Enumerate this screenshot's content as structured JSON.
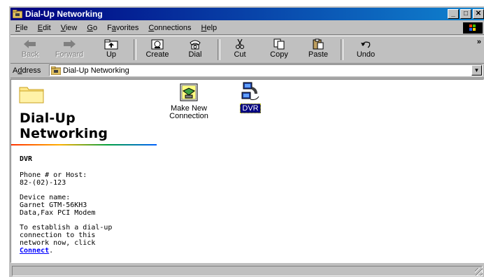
{
  "window": {
    "title": "Dial-Up Networking"
  },
  "title_buttons": {
    "minimize": "_",
    "maximize": "□",
    "close": "✕"
  },
  "menubar": {
    "items": [
      {
        "pre": "",
        "key": "F",
        "post": "ile"
      },
      {
        "pre": "",
        "key": "E",
        "post": "dit"
      },
      {
        "pre": "",
        "key": "V",
        "post": "iew"
      },
      {
        "pre": "",
        "key": "G",
        "post": "o"
      },
      {
        "pre": "F",
        "key": "a",
        "post": "vorites"
      },
      {
        "pre": "",
        "key": "C",
        "post": "onnections"
      },
      {
        "pre": "",
        "key": "H",
        "post": "elp"
      }
    ]
  },
  "toolbar": {
    "back": "Back",
    "forward": "Forward",
    "up": "Up",
    "create": "Create",
    "dial": "Dial",
    "cut": "Cut",
    "copy": "Copy",
    "paste": "Paste",
    "undo": "Undo",
    "more": "»"
  },
  "address": {
    "label_pre": "A",
    "label_key": "d",
    "label_post": "dress",
    "value": "Dial-Up Networking"
  },
  "leftpane": {
    "heading_line1": "Dial-Up",
    "heading_line2": "Networking",
    "selected_name": "DVR",
    "phone_label": "Phone # or Host:",
    "phone_value": "82-(02)-123",
    "device_label": "Device name:",
    "device_value_line1": "Garnet GTM-56KH3",
    "device_value_line2": "Data,Fax PCI Modem",
    "instruction_line1": "To establish a dial-up",
    "instruction_line2": "connection to this",
    "instruction_line3": "network now, click",
    "connect_link": "Connect",
    "instruction_end": "."
  },
  "icons": [
    {
      "name": "make-new-connection",
      "label_line1": "Make New",
      "label_line2": "Connection",
      "icon": "make-new-connection-icon"
    },
    {
      "name": "dvr",
      "label_line1": "DVR",
      "icon": "dialup-connection-icon",
      "selected": true
    }
  ],
  "colors": {
    "title_bar": "#000080",
    "selection": "#000080",
    "link": "#0000ff"
  }
}
